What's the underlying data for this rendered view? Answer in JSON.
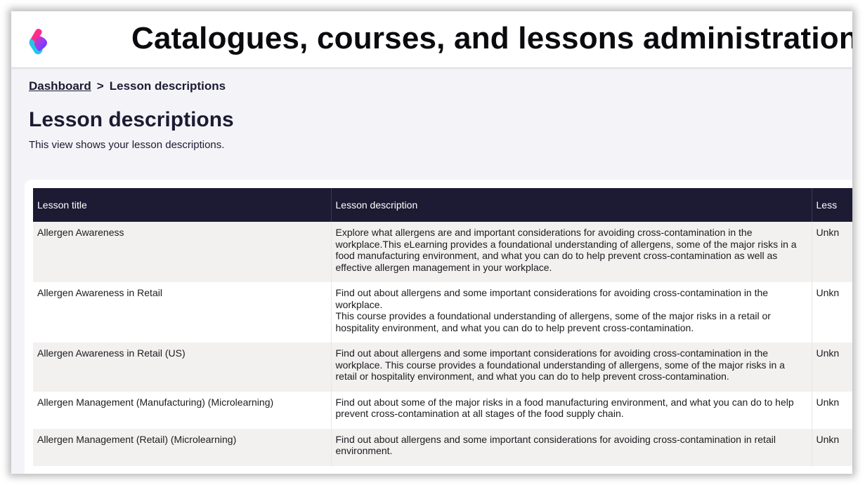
{
  "header": {
    "app_title": "Catalogues, courses, and lessons administration"
  },
  "breadcrumb": {
    "link": "Dashboard",
    "separator": ">",
    "current": "Lesson descriptions"
  },
  "page": {
    "title": "Lesson descriptions",
    "subtitle": "This view shows your lesson descriptions."
  },
  "table": {
    "columns": [
      "Lesson title",
      "Lesson description",
      "Less"
    ],
    "rows": [
      {
        "title": "Allergen Awareness",
        "description": [
          "Explore what allergens are and important considerations for avoiding cross-contamination in the workplace.This eLearning provides a foundational understanding of allergens, some of the major risks in a food manufacturing environment, and what you can do to help prevent cross-contamination as well as effective allergen management in your workplace."
        ],
        "col3": "Unkn"
      },
      {
        "title": "Allergen Awareness in Retail",
        "description": [
          "Find out about allergens and some important considerations for avoiding cross-contamination in the workplace.",
          "This course provides a foundational understanding of allergens, some of the major risks in a retail or hospitality environment, and what you can do to help prevent cross-contamination."
        ],
        "col3": "Unkn"
      },
      {
        "title": "Allergen Awareness in Retail (US)",
        "description": [
          "Find out about allergens and some important considerations for avoiding cross-contamination in the workplace. This course provides a foundational understanding of allergens, some of the major risks in a retail or hospitality environment, and what you can do to help prevent cross-contamination."
        ],
        "col3": "Unkn"
      },
      {
        "title": "Allergen Management (Manufacturing) (Microlearning)",
        "description": [
          "Find out about some of the major risks in a food manufacturing environment, and what you can do to help prevent cross-contamination at all stages of the food supply chain."
        ],
        "col3": "Unkn"
      },
      {
        "title": "Allergen Management (Retail) (Microlearning)",
        "description": [
          "Find out about allergens and some important considerations for avoiding cross-contamination in retail environment."
        ],
        "col3": "Unkn"
      }
    ]
  },
  "logo": {
    "icon": "brand-logo-icon",
    "colors": [
      "#ff2d8a",
      "#8a3cff",
      "#22c7e8"
    ]
  },
  "colors": {
    "header_row": "#1c1b33",
    "odd_row": "#f2f1f0",
    "page_bg": "#f4f4f8"
  }
}
